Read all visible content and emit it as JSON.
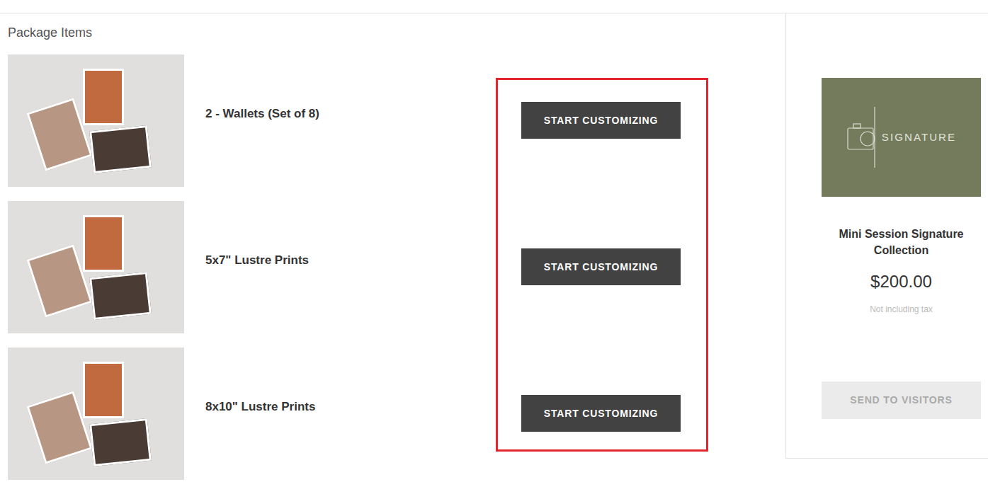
{
  "header": "Package Items",
  "items": [
    {
      "label": "2 - Wallets (Set of 8)",
      "button": "START CUSTOMIZING"
    },
    {
      "label": "5x7\" Lustre Prints",
      "button": "START CUSTOMIZING"
    },
    {
      "label": "8x10\" Lustre Prints",
      "button": "START CUSTOMIZING"
    }
  ],
  "package": {
    "logo_text": "SIGNATURE",
    "title": "Mini Session Signature Collection",
    "price": "$200.00",
    "tax_note": "Not including tax",
    "button": "SEND TO VISITORS",
    "button_disabled": true
  }
}
